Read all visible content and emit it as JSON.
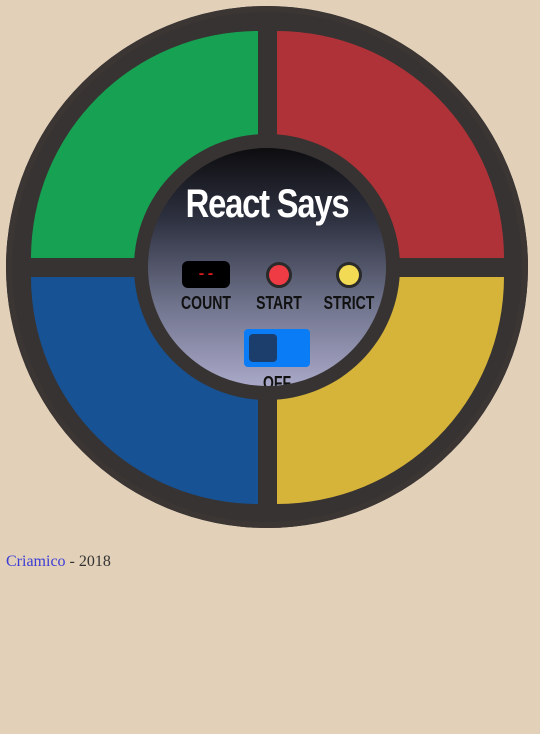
{
  "game": {
    "title": "React Says",
    "count_display": "--",
    "labels": {
      "count": "COUNT",
      "start": "START",
      "strict": "STRICT",
      "power": "OFF"
    },
    "power_on": false,
    "colors": {
      "green": "#17a152",
      "red": "#af3238",
      "blue": "#175294",
      "yellow": "#d6b43a",
      "board": "#373332",
      "start_led": "#ef3c44",
      "strict_led": "#f3da54",
      "switch_track": "#0a7cf5",
      "switch_knob": "#1b3e6d",
      "count_digits": "#e01b1b"
    }
  },
  "footer": {
    "author_link": "Criamico",
    "separator": " - ",
    "year": "2018"
  }
}
